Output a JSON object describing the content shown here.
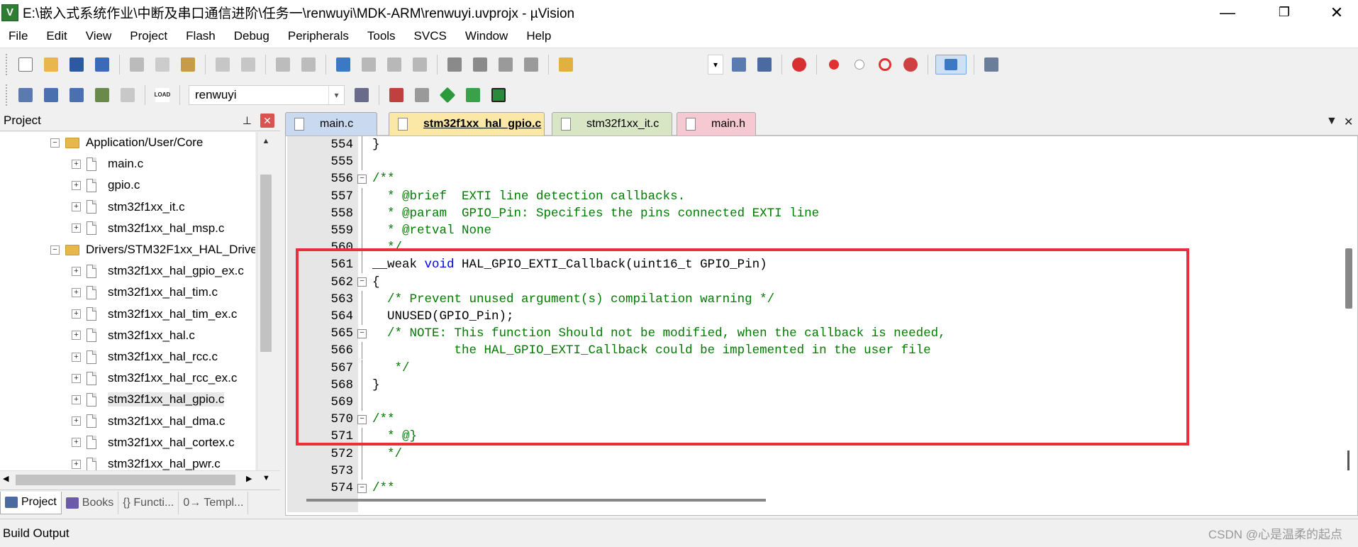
{
  "window": {
    "title": "E:\\嵌入式系统作业\\中断及串口通信进阶\\任务一\\renwuyi\\MDK-ARM\\renwuyi.uvprojx - µVision",
    "logo_text": "V",
    "minimize": "—",
    "restore": "❐",
    "close": "✕"
  },
  "menu": [
    "File",
    "Edit",
    "View",
    "Project",
    "Flash",
    "Debug",
    "Peripherals",
    "Tools",
    "SVCS",
    "Window",
    "Help"
  ],
  "toolbar2": {
    "target_name": "renwuyi",
    "load_label": "LOAD"
  },
  "project_panel": {
    "title": "Project",
    "pin": "⊥",
    "close": "✕",
    "tree": [
      {
        "label": "Application/User/Core",
        "type": "folder",
        "expander": "−"
      },
      {
        "label": "main.c",
        "type": "file",
        "expander": "+"
      },
      {
        "label": "gpio.c",
        "type": "file",
        "expander": "+"
      },
      {
        "label": "stm32f1xx_it.c",
        "type": "file",
        "expander": "+"
      },
      {
        "label": "stm32f1xx_hal_msp.c",
        "type": "file",
        "expander": "+"
      },
      {
        "label": "Drivers/STM32F1xx_HAL_Drive",
        "type": "folder",
        "expander": "−"
      },
      {
        "label": "stm32f1xx_hal_gpio_ex.c",
        "type": "file",
        "expander": "+"
      },
      {
        "label": "stm32f1xx_hal_tim.c",
        "type": "file",
        "expander": "+"
      },
      {
        "label": "stm32f1xx_hal_tim_ex.c",
        "type": "file",
        "expander": "+"
      },
      {
        "label": "stm32f1xx_hal.c",
        "type": "file",
        "expander": "+"
      },
      {
        "label": "stm32f1xx_hal_rcc.c",
        "type": "file",
        "expander": "+"
      },
      {
        "label": "stm32f1xx_hal_rcc_ex.c",
        "type": "file",
        "expander": "+"
      },
      {
        "label": "stm32f1xx_hal_gpio.c",
        "type": "file",
        "expander": "+"
      },
      {
        "label": "stm32f1xx_hal_dma.c",
        "type": "file",
        "expander": "+"
      },
      {
        "label": "stm32f1xx_hal_cortex.c",
        "type": "file",
        "expander": "+"
      },
      {
        "label": "stm32f1xx_hal_pwr.c",
        "type": "file",
        "expander": "+"
      }
    ],
    "selected_index": 12,
    "bottom_tabs": [
      "Project",
      "Books",
      "{} Functi...",
      "0→ Templ..."
    ]
  },
  "editor": {
    "tabs": [
      {
        "label": "main.c",
        "color": "#c9d9f0"
      },
      {
        "label": "stm32f1xx_hal_gpio.c",
        "color": "#fbe7a6",
        "active": true
      },
      {
        "label": "stm32f1xx_it.c",
        "color": "#d8e6c6"
      },
      {
        "label": "main.h",
        "color": "#f6c9d2"
      }
    ],
    "tab_dropdown": "▼",
    "tab_close": "✕",
    "lines": [
      {
        "n": "554",
        "fold": "",
        "segs": [
          [
            "t",
            "}"
          ]
        ]
      },
      {
        "n": "555",
        "fold": "",
        "segs": []
      },
      {
        "n": "556",
        "fold": "−",
        "segs": [
          [
            "c",
            "/**"
          ]
        ]
      },
      {
        "n": "557",
        "fold": "",
        "segs": [
          [
            "c",
            "  * @brief  EXTI line detection callbacks."
          ]
        ]
      },
      {
        "n": "558",
        "fold": "",
        "segs": [
          [
            "c",
            "  * @param  GPIO_Pin: Specifies the pins connected EXTI line"
          ]
        ]
      },
      {
        "n": "559",
        "fold": "",
        "segs": [
          [
            "c",
            "  * @retval None"
          ]
        ]
      },
      {
        "n": "560",
        "fold": "",
        "segs": [
          [
            "c",
            "  */"
          ]
        ]
      },
      {
        "n": "561",
        "fold": "",
        "segs": [
          [
            "t",
            "__weak "
          ],
          [
            "k",
            "void"
          ],
          [
            "t",
            " HAL_GPIO_EXTI_Callback(uint16_t GPIO_Pin)"
          ]
        ]
      },
      {
        "n": "562",
        "fold": "−",
        "segs": [
          [
            "t",
            "{"
          ]
        ]
      },
      {
        "n": "563",
        "fold": "",
        "segs": [
          [
            "c",
            "  /* Prevent unused argument(s) compilation warning */"
          ]
        ]
      },
      {
        "n": "564",
        "fold": "",
        "segs": [
          [
            "t",
            "  UNUSED(GPIO_Pin);"
          ]
        ]
      },
      {
        "n": "565",
        "fold": "−",
        "segs": [
          [
            "c",
            "  /* NOTE: This function Should not be modified, when the callback is needed,"
          ]
        ]
      },
      {
        "n": "566",
        "fold": "",
        "segs": [
          [
            "c",
            "           the HAL_GPIO_EXTI_Callback could be implemented in the user file"
          ]
        ]
      },
      {
        "n": "567",
        "fold": "",
        "segs": [
          [
            "c",
            "   */"
          ]
        ]
      },
      {
        "n": "568",
        "fold": "",
        "segs": [
          [
            "t",
            "}"
          ]
        ]
      },
      {
        "n": "569",
        "fold": "",
        "segs": []
      },
      {
        "n": "570",
        "fold": "−",
        "segs": [
          [
            "c",
            "/**"
          ]
        ]
      },
      {
        "n": "571",
        "fold": "",
        "segs": [
          [
            "c",
            "  * @}"
          ]
        ]
      },
      {
        "n": "572",
        "fold": "",
        "segs": [
          [
            "c",
            "  */"
          ]
        ]
      },
      {
        "n": "573",
        "fold": "",
        "segs": []
      },
      {
        "n": "574",
        "fold": "−",
        "segs": [
          [
            "c",
            "/**"
          ]
        ]
      }
    ]
  },
  "build_output": {
    "title": "Build Output"
  },
  "watermark": "CSDN @心是温柔的起点",
  "colors": {
    "comment": "#007a00",
    "keyword": "#0000e0",
    "highlight_box": "#e8303a"
  }
}
